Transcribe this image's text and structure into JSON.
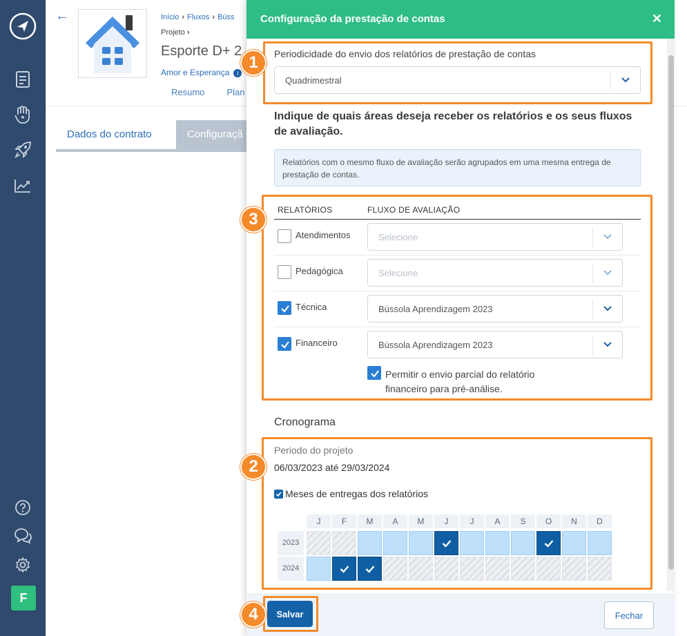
{
  "sidebar": {
    "icons": [
      "logo-icon",
      "document-icon",
      "hand-heart-icon",
      "rocket-icon",
      "chart-icon",
      "help-icon",
      "chat-icon",
      "gear-icon"
    ],
    "avatar_initial": "F"
  },
  "background": {
    "breadcrumbs": [
      "Início",
      "Fluxos",
      "Búss"
    ],
    "breadcrumb_sub": "Projeto",
    "project_title": "Esporte D+ 2",
    "project_org": "Amor e Esperança",
    "project_tabs": [
      "Resumo",
      "Plan"
    ],
    "sub_tabs": [
      "Dados do contrato",
      "Configuraçã"
    ]
  },
  "panel": {
    "title": "Configuração da prestação de contas",
    "periodicity_label": "Periodicidade do envio dos relatórios de prestação de contas",
    "periodicity_value": "Quadrimestral",
    "areas_heading": "Indique de quais áreas deseja receber os relatórios e os seus fluxos de avaliação.",
    "info_text": "Relatórios com o mesmo fluxo de avaliação serão agrupados em uma mesma entrega de prestação de contas.",
    "col_reports": "RELATÓRIOS",
    "col_flow": "FLUXO DE AVALIAÇÃO",
    "rows": [
      {
        "label": "Atendimentos",
        "checked": false,
        "flow": "Selecione",
        "disabled": true
      },
      {
        "label": "Pedagógica",
        "checked": false,
        "flow": "Selecione",
        "disabled": true
      },
      {
        "label": "Técnica",
        "checked": true,
        "flow": "Bússola Aprendizagem 2023",
        "disabled": false
      },
      {
        "label": "Financeiro",
        "checked": true,
        "flow": "Bússola Aprendizagem 2023",
        "disabled": false
      }
    ],
    "partial_line1": "Permitir o envio parcial do relatório",
    "partial_line2": "financeiro para pré-análise.",
    "schedule_title": "Cronograma",
    "period_label": "Periodo do projeto",
    "period_value": "06/03/2023 até 29/03/2024",
    "months_label": "Meses de entregas dos relatórios",
    "months": [
      "J",
      "F",
      "M",
      "A",
      "M",
      "J",
      "J",
      "A",
      "S",
      "O",
      "N",
      "D"
    ],
    "years": [
      "2023",
      "2024"
    ],
    "calendar": [
      [
        "dis",
        "dis",
        "avail",
        "avail",
        "avail",
        "sel",
        "avail",
        "avail",
        "avail",
        "sel",
        "avail",
        "avail"
      ],
      [
        "avail",
        "sel",
        "sel",
        "dis",
        "dis",
        "dis",
        "dis",
        "dis",
        "dis",
        "dis",
        "dis",
        "dis"
      ]
    ],
    "save_label": "Salvar",
    "close_label": "Fechar"
  },
  "steps": [
    "1",
    "2",
    "3",
    "4"
  ],
  "colors": {
    "accent_green": "#2ebd85",
    "highlight_orange": "#f58a2b",
    "primary_blue": "#1462a8",
    "sidebar": "#2f4a6d"
  }
}
